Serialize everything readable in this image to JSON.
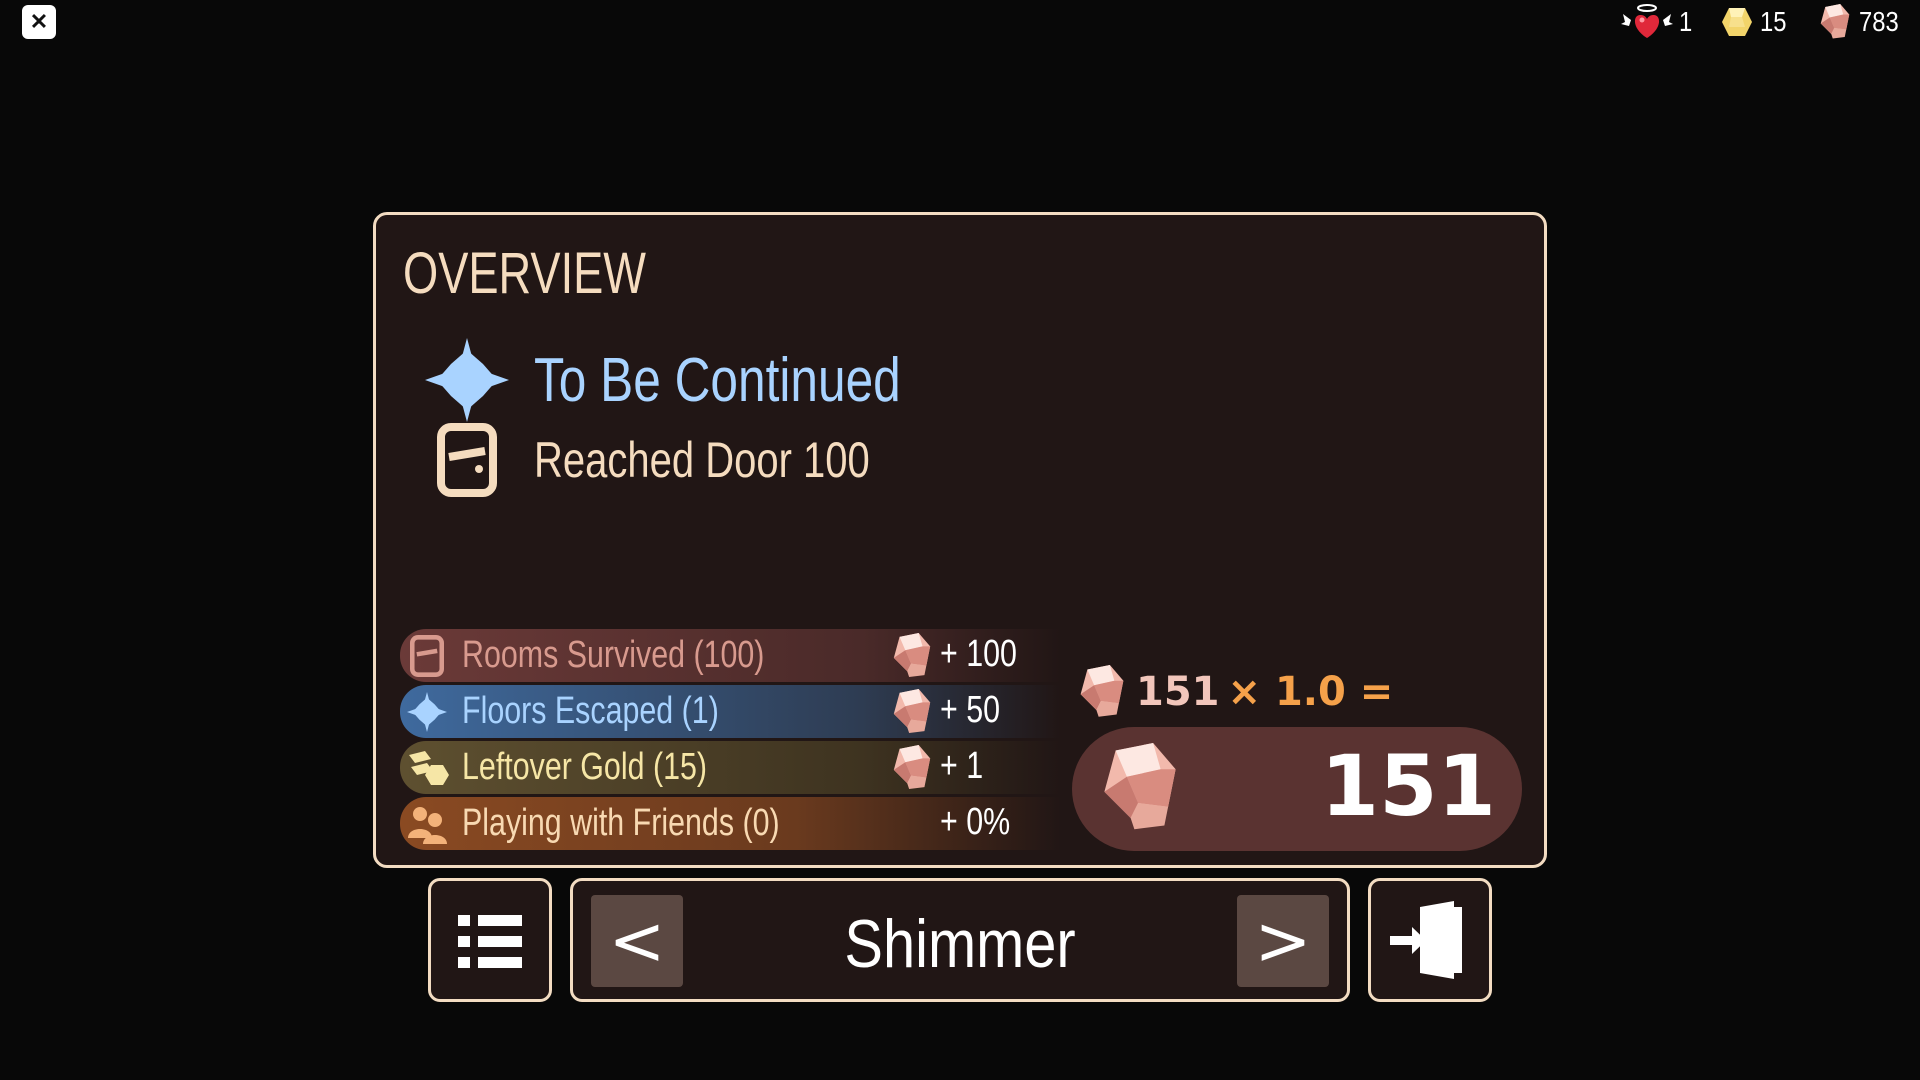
{
  "top_bar": {
    "close_label": "✕",
    "stats": [
      {
        "name": "revives",
        "icon": "winged-heart-icon",
        "value": "1"
      },
      {
        "name": "gold",
        "icon": "gold-coin-icon",
        "value": "15"
      },
      {
        "name": "knobs",
        "icon": "knob-gem-icon",
        "value": "783"
      }
    ]
  },
  "overview": {
    "title": "OVERVIEW",
    "achievement": {
      "icon": "sparkle-star-icon",
      "title": "To Be Continued"
    },
    "reached": {
      "icon": "door-icon",
      "text": "Reached Door 100"
    },
    "rewards": [
      {
        "icon": "door-icon",
        "label": "Rooms Survived (100)",
        "value": "+ 100",
        "has_gem": true,
        "color": "#d89a8e"
      },
      {
        "icon": "sparkle-star-icon",
        "label": "Floors Escaped (1)",
        "value": "+ 50",
        "has_gem": true,
        "color": "#a9d3ff"
      },
      {
        "icon": "gold-coins-icon",
        "label": "Leftover Gold (15)",
        "value": "+ 1",
        "has_gem": true,
        "color": "#f6e6a6"
      },
      {
        "icon": "friends-icon",
        "label": "Playing with Friends (0)",
        "value": "+ 0%",
        "has_gem": false,
        "color": "#f8d9b2"
      }
    ],
    "multiplier": {
      "base": "151",
      "operator": "× 1.0 ="
    },
    "total": "151"
  },
  "bottom_nav": {
    "menu_icon": "list-icon",
    "prev_label": "<",
    "next_label": ">",
    "mode_name": "Shimmer",
    "exit_icon": "exit-door-icon"
  },
  "colors": {
    "panel_bg": "#211615",
    "panel_border": "#f3dcc2",
    "accent_orange": "#f5a14a",
    "title_blue": "#a9d3ff"
  }
}
